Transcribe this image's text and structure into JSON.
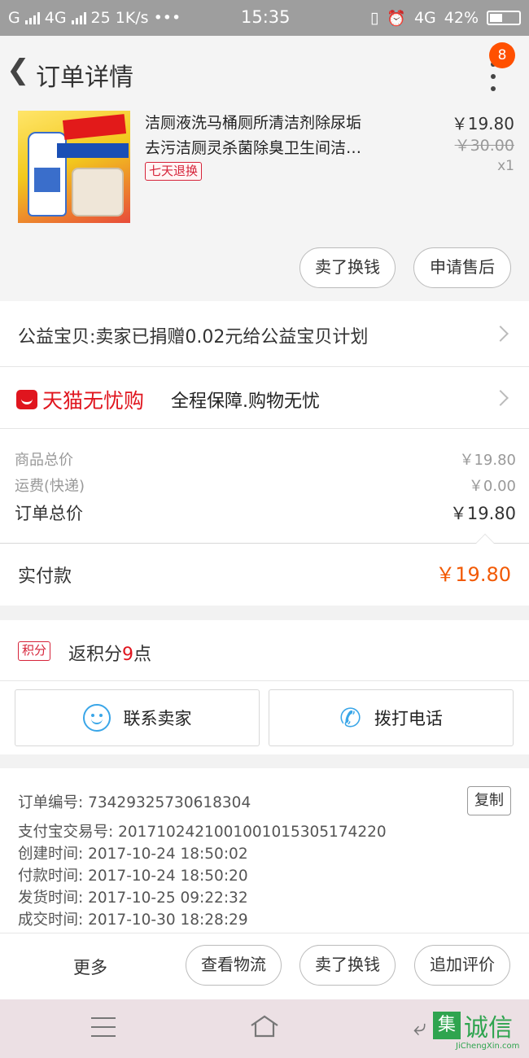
{
  "status_bar": {
    "carrier_1": "G",
    "network": "4G",
    "speed": "25",
    "rate": "1K/s",
    "more": "•••",
    "time": "15:35",
    "net2": "4G",
    "battery": "42%"
  },
  "header": {
    "title": "订单详情",
    "badge_count": "8"
  },
  "product": {
    "name_line1": "洁厕液洗马桶厕所清洁剂除尿垢",
    "name_line2": "去污洁厕灵杀菌除臭卫生间洁…",
    "return_policy": "七天退换",
    "price": "￥19.80",
    "original_price": "￥30.00",
    "quantity": "x1",
    "buttons": {
      "resell": "卖了换钱",
      "after_sale": "申请售后"
    }
  },
  "charity": {
    "text": "公益宝贝:卖家已捐赠0.02元给公益宝贝计划"
  },
  "tmall": {
    "brand": "天猫无忧购",
    "slogan": "全程保障.购物无忧"
  },
  "summary": {
    "goods_label": "商品总价",
    "goods_value": "￥19.80",
    "shipping_label": "运费(快递)",
    "shipping_value": "￥0.00",
    "total_label": "订单总价",
    "total_value": "￥19.80"
  },
  "payment": {
    "label": "实付款",
    "value": "￥19.80"
  },
  "points": {
    "tag": "积分",
    "prefix": "返积分",
    "count": "9",
    "suffix": "点"
  },
  "contact": {
    "seller": "联系卖家",
    "call": "拨打电话"
  },
  "order_info": {
    "order_no": "订单编号: 73429325730618304",
    "copy": "复制",
    "alipay_no": "支付宝交易号: 2017102421001001015305174220",
    "created": "创建时间: 2017-10-24  18:50:02",
    "paid": "付款时间: 2017-10-24  18:50:20",
    "shipped": "发货时间: 2017-10-25  09:22:32",
    "completed": "成交时间: 2017-10-30  18:28:29"
  },
  "bottom_actions": {
    "more": "更多",
    "logistics": "查看物流",
    "resell": "卖了换钱",
    "review": "追加评价"
  },
  "watermark": {
    "logo_char": "集",
    "text": "诚信",
    "url": "JiChengXin.com"
  }
}
